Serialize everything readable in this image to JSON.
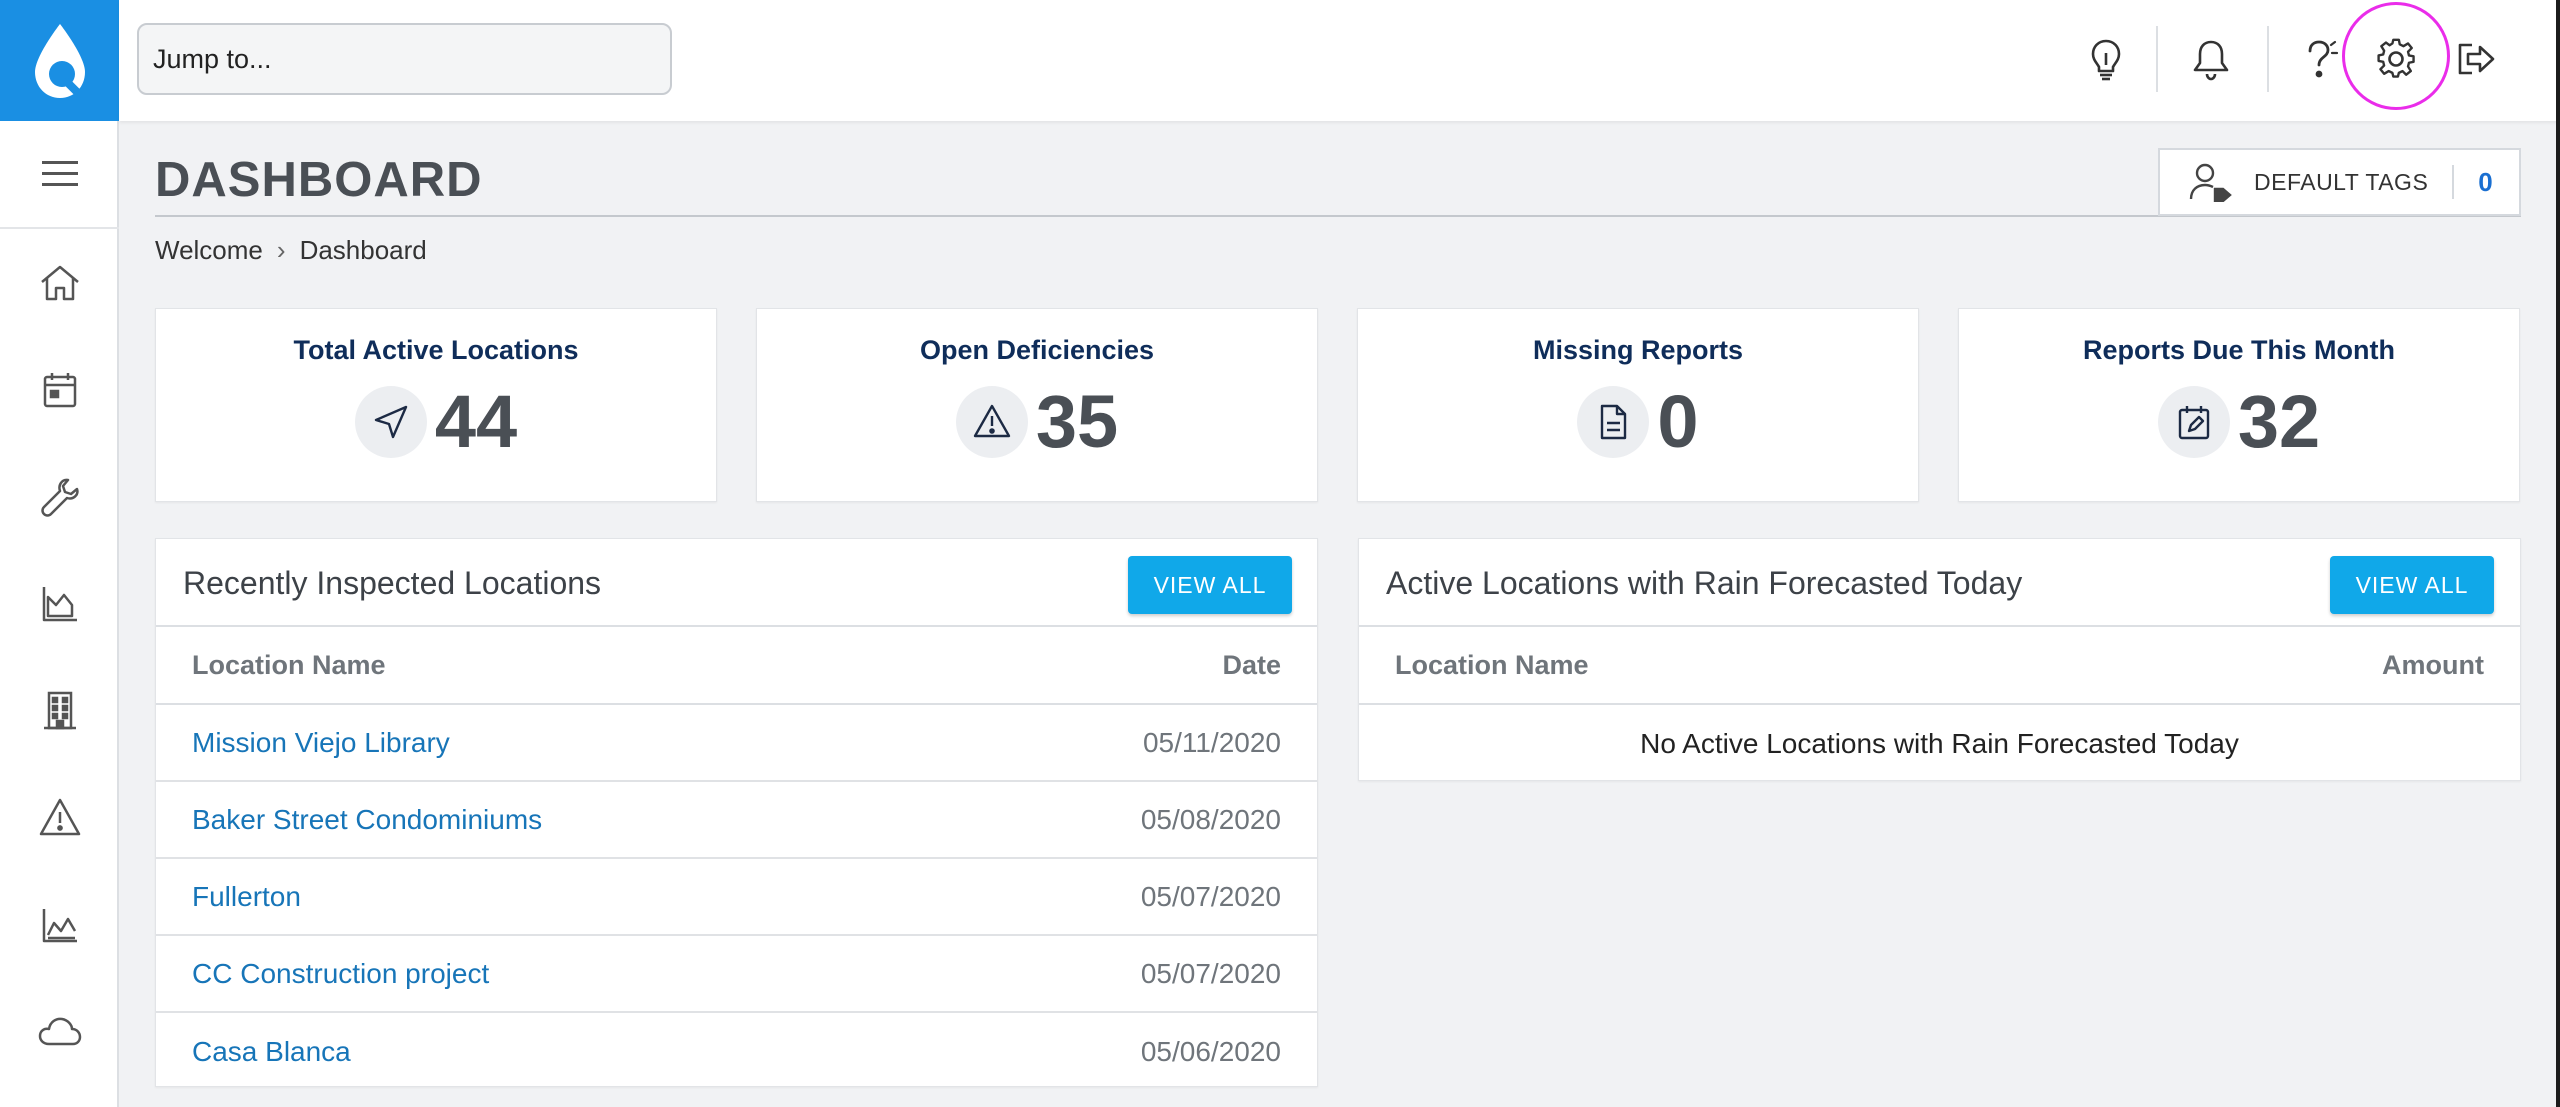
{
  "app": {
    "accent_color": "#1a8fe3",
    "button_color": "#10a8e9",
    "link_color": "#1775b8",
    "highlight_ring_color": "#ea2cea"
  },
  "topbar": {
    "search_placeholder": "Jump to...",
    "icons": [
      "lightbulb-icon",
      "bell-icon",
      "help-icon",
      "settings-gear-icon",
      "logout-icon"
    ]
  },
  "sidebar": {
    "items": [
      {
        "icon": "home-icon"
      },
      {
        "icon": "calendar-icon"
      },
      {
        "icon": "wrench-icon"
      },
      {
        "icon": "area-chart-icon"
      },
      {
        "icon": "building-icon"
      },
      {
        "icon": "warning-icon"
      },
      {
        "icon": "line-chart-icon"
      },
      {
        "icon": "cloud-icon"
      }
    ]
  },
  "header": {
    "title": "DASHBOARD",
    "breadcrumb": [
      "Welcome",
      "Dashboard"
    ],
    "breadcrumb_separator": "›",
    "default_tags_label": "DEFAULT TAGS",
    "default_tags_count": "0"
  },
  "stats": [
    {
      "label": "Total Active Locations",
      "value": "44",
      "icon": "navigation-arrow-icon"
    },
    {
      "label": "Open Deficiencies",
      "value": "35",
      "icon": "warning-icon"
    },
    {
      "label": "Missing Reports",
      "value": "0",
      "icon": "document-icon"
    },
    {
      "label": "Reports Due This Month",
      "value": "32",
      "icon": "calendar-edit-icon"
    }
  ],
  "recent_panel": {
    "title": "Recently Inspected Locations",
    "view_all_label": "VIEW ALL",
    "columns": [
      "Location Name",
      "Date"
    ],
    "rows": [
      {
        "name": "Mission Viejo Library",
        "date": "05/11/2020"
      },
      {
        "name": "Baker Street Condominiums",
        "date": "05/08/2020"
      },
      {
        "name": "Fullerton",
        "date": "05/07/2020"
      },
      {
        "name": "CC Construction project",
        "date": "05/07/2020"
      },
      {
        "name": "Casa Blanca",
        "date": "05/06/2020"
      }
    ]
  },
  "rain_panel": {
    "title": "Active Locations with Rain Forecasted Today",
    "view_all_label": "VIEW ALL",
    "columns": [
      "Location Name",
      "Amount"
    ],
    "empty_message": "No Active Locations with Rain Forecasted Today"
  }
}
